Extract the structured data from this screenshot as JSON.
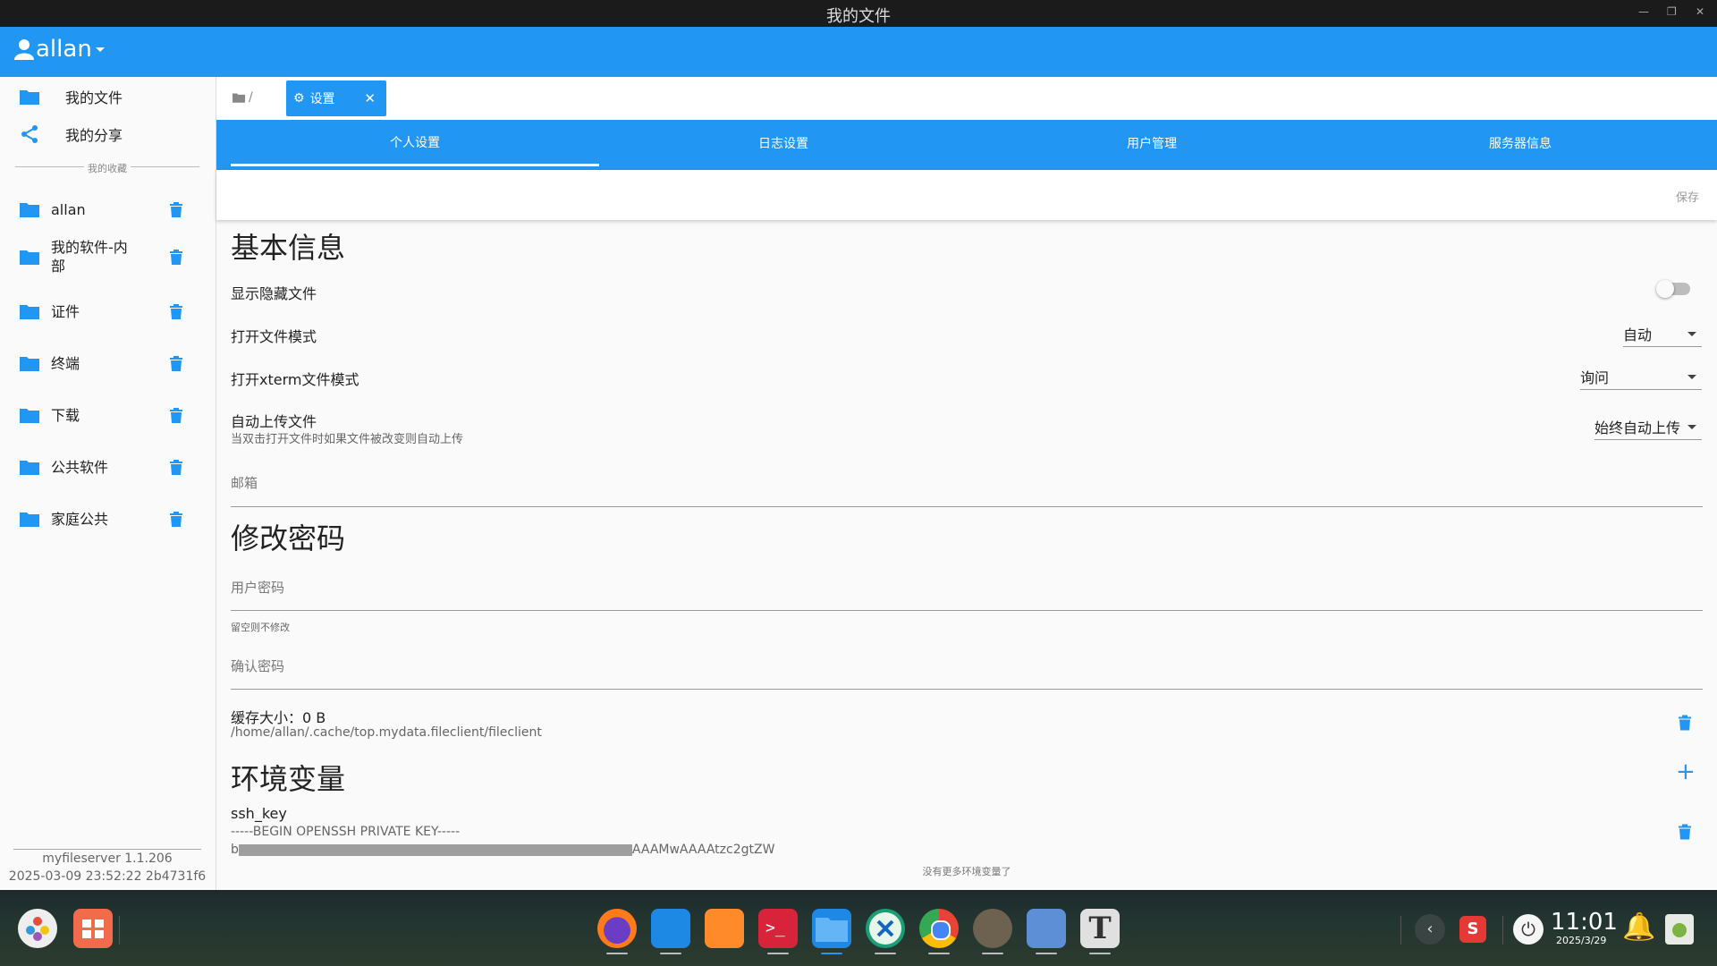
{
  "window": {
    "title": "我的文件"
  },
  "header": {
    "user": "allan"
  },
  "sidebar": {
    "nav": [
      {
        "label": "我的文件"
      },
      {
        "label": "我的分享"
      }
    ],
    "favorites_label": "我的收藏",
    "favorites": [
      {
        "label": "allan"
      },
      {
        "label": "我的软件-内部"
      },
      {
        "label": "证件"
      },
      {
        "label": "终端"
      },
      {
        "label": "下载"
      },
      {
        "label": "公共软件"
      },
      {
        "label": "家庭公共"
      }
    ],
    "version": "myfileserver 1.1.206",
    "build": "2025-03-09 23:52:22 2b4731f6"
  },
  "breadcrumb": {
    "path": "/"
  },
  "open_tab": {
    "label": "设置"
  },
  "settings_tabs": [
    {
      "label": "个人设置"
    },
    {
      "label": "日志设置"
    },
    {
      "label": "用户管理"
    },
    {
      "label": "服务器信息"
    }
  ],
  "toolbar": {
    "save": "保存"
  },
  "basic": {
    "heading": "基本信息",
    "show_hidden": "显示隐藏文件",
    "show_hidden_value": false,
    "open_mode": "打开文件模式",
    "open_mode_value": "自动",
    "xterm_mode": "打开xterm文件模式",
    "xterm_mode_value": "询问",
    "auto_upload": "自动上传文件",
    "auto_upload_desc": "当双击打开文件时如果文件被改变则自动上传",
    "auto_upload_value": "始终自动上传",
    "email_placeholder": "邮箱"
  },
  "password": {
    "heading": "修改密码",
    "user_password": "用户密码",
    "hint": "留空则不修改",
    "confirm": "确认密码"
  },
  "cache": {
    "label": "缓存大小：0 B",
    "path": "/home/allan/.cache/top.mydata.fileclient/fileclient"
  },
  "env": {
    "heading": "环境变量",
    "items": [
      {
        "name": "ssh_key",
        "line1": "-----BEGIN OPENSSH PRIVATE KEY-----",
        "line2_start": "b",
        "line2_end": "AAAMwAAAAtzc2gtZW"
      }
    ],
    "footer": "没有更多环境变量了"
  },
  "taskbar": {
    "time": "11:01",
    "date": "2025/3/29"
  },
  "colors": {
    "accent": "#2196f3"
  }
}
